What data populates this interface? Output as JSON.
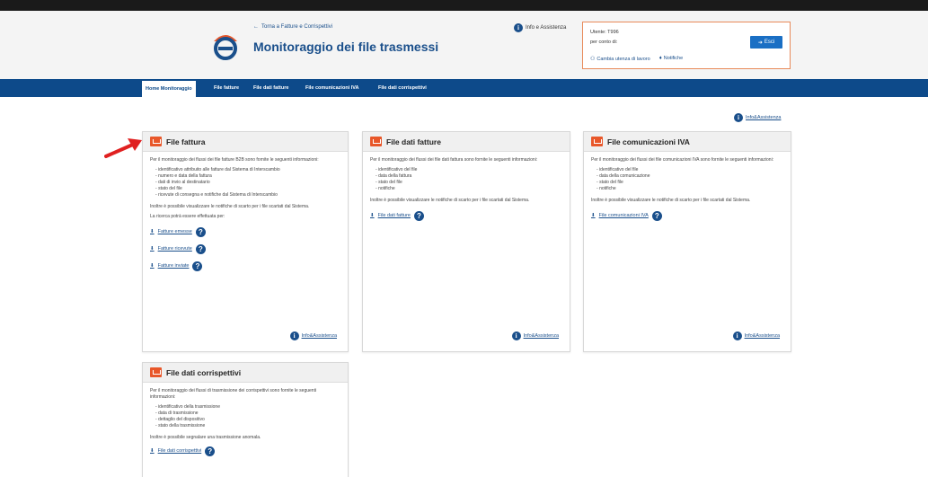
{
  "header": {
    "back_link": "Torna a Fatture e Corrispettivi",
    "title": "Monitoraggio dei file trasmessi",
    "info_link": "Info e Assistenza"
  },
  "user": {
    "line1": "Utente: T996",
    "line2": "per conto di:",
    "change_user": "Cambia utenza di lavoro",
    "notifications": "Notifiche",
    "exit": "Esci"
  },
  "nav": {
    "items": [
      "Home Monitoraggio",
      "File fatture",
      "File dati fatture",
      "File comunicazioni IVA",
      "File dati corrispettivi"
    ]
  },
  "info_assistenza": "Info&Assistenza",
  "cards": {
    "fattura": {
      "title": "File fattura",
      "intro": "Per il monitoraggio dei flussi dei file fatture B2B sono fornite le seguenti informazioni:",
      "items": [
        "identificativo attribuito alle fatture dal Sistema di Interscambio",
        "numero e data della fattura",
        "dati di invio al destinatario",
        "stato del file",
        "ricevute di consegna e notifiche dal Sistema di Interscambio"
      ],
      "note": "Inoltre è possibile visualizzare le notifiche di scarto per i file scartati dal Sistema.",
      "search_label": "La ricerca potrà essere effettuata per:",
      "links": [
        "Fatture emesse",
        "Fatture ricevute",
        "Fatture inviate"
      ],
      "info": "Info&Assistenza"
    },
    "dati_fatture": {
      "title": "File dati fatture",
      "intro": "Per il monitoraggio dei flussi dei file dati fattura sono fornite le seguenti informazioni:",
      "items": [
        "identificativo del file",
        "data della fattura",
        "stato del file",
        "notifiche"
      ],
      "note": "Inoltre è possibile visualizzare le notifiche di scarto per i file scartati dal Sistema.",
      "link": "File dati fatture",
      "info": "Info&Assistenza"
    },
    "comunicazioni_iva": {
      "title": "File comunicazioni IVA",
      "intro": "Per il monitoraggio dei flussi dei file comunicazioni IVA sono fornite le seguenti informazioni:",
      "items": [
        "identificativo del file",
        "data della comunicazione",
        "stato del file",
        "notifiche"
      ],
      "note": "Inoltre è possibile visualizzare le notifiche di scarto per i file scartati dal Sistema.",
      "link": "File comunicazioni IVA",
      "info": "Info&Assistenza"
    },
    "corrispettivi": {
      "title": "File dati corrispettivi",
      "intro": "Per il monitoraggio dei flussi di trasmissione dei corrispettivi sono fornite le seguenti informazioni:",
      "items": [
        "identificativo della trasmissione",
        "data di trasmissione",
        "dettaglio del dispositivo",
        "stato della trasmissione"
      ],
      "note": "Inoltre è possibile segnalare una trasmissione anomala.",
      "link": "File dati corrispettivi"
    }
  },
  "colors": {
    "brand_blue": "#0d4a8a",
    "accent_orange": "#e8572a",
    "arrow_red": "#e02020"
  }
}
